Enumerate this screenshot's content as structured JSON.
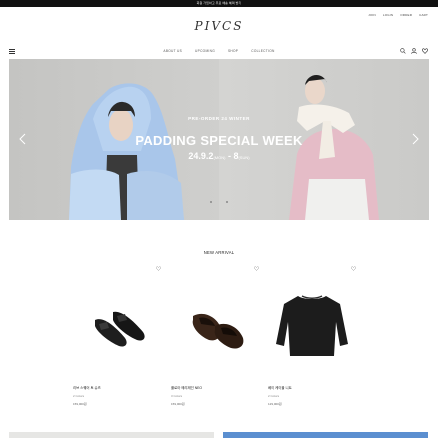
{
  "announcement": "회원 가입하고 무료 배송 혜택 받기",
  "utility_links": [
    "JOIN",
    "LOGIN",
    "ORDER",
    "CART"
  ],
  "brand": {
    "logo_text": "PIVCS"
  },
  "nav": {
    "menu": [
      "ABOUT US",
      "UPCOMING",
      "SHOP",
      "COLLECTION"
    ],
    "icons": [
      "menu-icon",
      "search-icon",
      "user-icon",
      "heart-icon"
    ]
  },
  "hero": {
    "eyebrow": "PRE-ORDER 24 WINTER",
    "headline": "PADDING SPECIAL WEEK",
    "date_start": "24.9.2",
    "day_start": "(MON)",
    "date_end": "8",
    "day_end": "(SUN)"
  },
  "section": {
    "title": "NEW ARRIVAL"
  },
  "products": [
    {
      "name": "리브 스퀘어 토 슈즈",
      "colors": "2 Colors",
      "price": "159,000원"
    },
    {
      "name": "플로아 메리제인 NEO",
      "colors": "3 Colors",
      "price": "159,000원"
    },
    {
      "name": "베이 케이블 니트",
      "colors": "2 Colors",
      "price": "129,000원"
    }
  ]
}
